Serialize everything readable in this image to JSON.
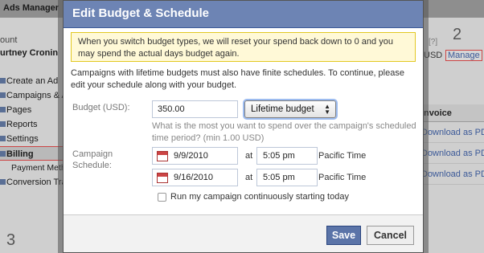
{
  "background": {
    "app_title": "Ads Manager",
    "top_snippet": "",
    "account_label": "ount",
    "account_name": "urtney Cronin",
    "nav": [
      {
        "label": "Create an Ad"
      },
      {
        "label": "Campaigns & A"
      },
      {
        "label": "Pages"
      },
      {
        "label": "Reports"
      },
      {
        "label": "Settings"
      },
      {
        "label": "Billing"
      },
      {
        "label": "Payment Meth"
      },
      {
        "label": "Conversion Tra"
      }
    ],
    "step_2": "2",
    "step_3": "3",
    "question": "[?]",
    "currency": "USD",
    "manage_link": "Manage",
    "table_header": "Invoice",
    "table_rows": [
      "Download as PDF",
      "Download as PDF",
      "Download as PDF"
    ]
  },
  "dialog": {
    "title": "Edit Budget & Schedule",
    "warning": "When you switch budget types, we will reset your spend back down to 0 and you may spend the actual days budget again.",
    "info": "Campaigns with lifetime budgets must also have finite schedules. To continue, please edit your schedule along with your budget.",
    "budget_label": "Budget (USD):",
    "budget_value": "350.00",
    "budget_type": "Lifetime budget",
    "budget_hint": "What is the most you want to spend over the campaign's scheduled time period? (min 1.00 USD)",
    "schedule_label": "Campaign Schedule:",
    "start_date": "9/9/2010",
    "start_at": "at",
    "start_time": "5:05 pm",
    "start_tz": "Pacific Time",
    "end_date": "9/16/2010",
    "end_at": "at",
    "end_time": "5:05 pm",
    "end_tz": "Pacific Time",
    "continuous_label": "Run my campaign continuously starting today",
    "save_label": "Save",
    "cancel_label": "Cancel"
  }
}
